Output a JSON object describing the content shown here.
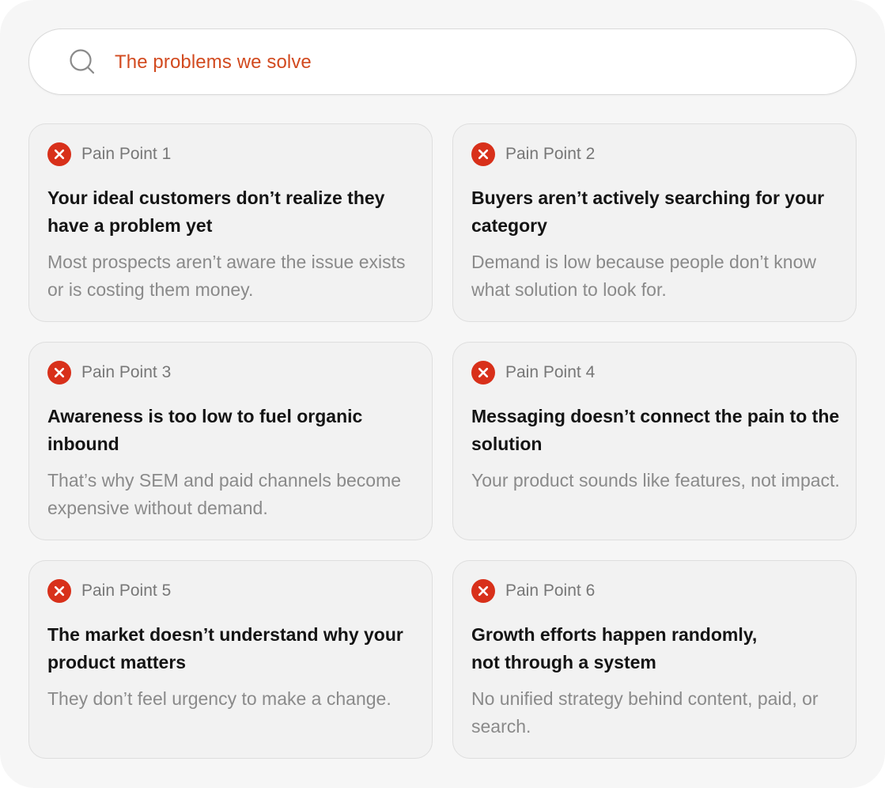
{
  "search": {
    "placeholder": "The problems we solve",
    "accent_color": "#d24a1f",
    "icon": "search-icon"
  },
  "cards": [
    {
      "badge": "Pain Point 1",
      "title": "Your ideal customers don’t realize they have a problem yet",
      "description": "Most prospects aren’t aware the issue exists or is costing them money.",
      "icon": "x-circle-icon"
    },
    {
      "badge": "Pain Point 2",
      "title": "Buyers aren’t actively searching for your category",
      "description": "Demand is low because people don’t know what solution to look for.",
      "icon": "x-circle-icon"
    },
    {
      "badge": "Pain Point 3",
      "title": "Awareness is too low to fuel organic inbound",
      "description": "That’s why SEM and paid channels become expensive without demand.",
      "icon": "x-circle-icon"
    },
    {
      "badge": "Pain Point 4",
      "title": "Messaging doesn’t connect the pain to the solution",
      "description": "Your product sounds like features, not impact.",
      "icon": "x-circle-icon"
    },
    {
      "badge": "Pain Point 5",
      "title": "The market doesn’t understand why your product matters",
      "description": "They don’t feel urgency to make a change.",
      "icon": "x-circle-icon"
    },
    {
      "badge": "Pain Point 6",
      "title": "Growth efforts happen randomly, not through a system",
      "description": "No unified strategy behind content, paid, or search.",
      "icon": "x-circle-icon"
    }
  ],
  "colors": {
    "icon_red": "#d8301a",
    "background": "#f6f6f6",
    "card_background": "#f2f2f2"
  }
}
